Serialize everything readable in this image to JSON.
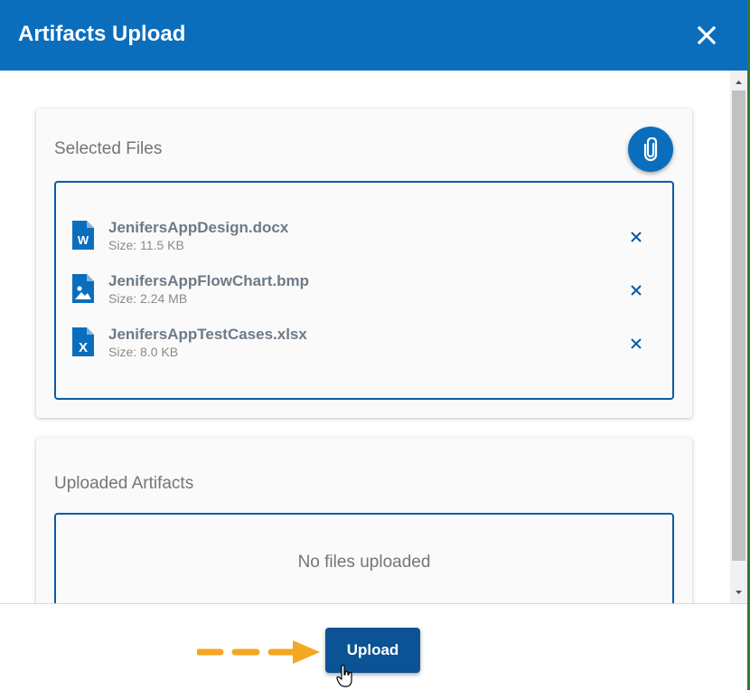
{
  "dialog": {
    "title": "Artifacts Upload",
    "close_icon": "close-icon"
  },
  "selected_files": {
    "title": "Selected Files",
    "attach_icon": "paperclip-icon",
    "files": [
      {
        "name": "JenifersAppDesign.docx",
        "size": "Size: 11.5 KB",
        "icon": "word-file-icon",
        "icon_letter": "W"
      },
      {
        "name": "JenifersAppFlowChart.bmp",
        "size": "Size: 2.24 MB",
        "icon": "image-file-icon"
      },
      {
        "name": "JenifersAppTestCases.xlsx",
        "size": "Size: 8.0 KB",
        "icon": "excel-file-icon",
        "icon_letter": "X"
      }
    ]
  },
  "uploaded_artifacts": {
    "title": "Uploaded Artifacts",
    "empty_text": "No files uploaded"
  },
  "footer": {
    "upload_label": "Upload"
  },
  "colors": {
    "header": "#0a6ebd",
    "accent": "#0a5ca8",
    "upload_button": "#0b5394",
    "arrow": "#f5a623"
  }
}
